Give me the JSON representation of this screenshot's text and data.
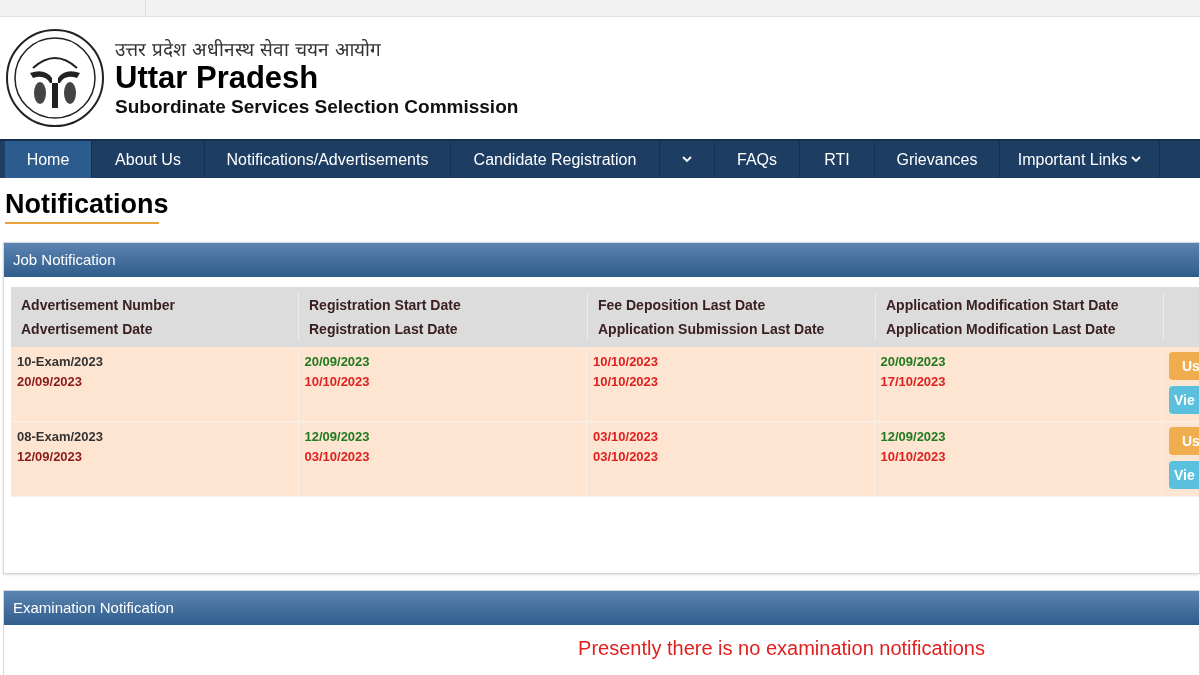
{
  "header": {
    "hindi_title": "उत्तर प्रदेश अधीनस्थ सेवा चयन आयोग",
    "title": "Uttar Pradesh",
    "subtitle": "Subordinate Services Selection Commission"
  },
  "nav": [
    {
      "label": "Home",
      "selected": true,
      "kind": "link"
    },
    {
      "label": "About Us",
      "selected": false,
      "kind": "link"
    },
    {
      "label": "Notifications/Advertisements",
      "selected": false,
      "kind": "link"
    },
    {
      "label": "Candidate Registration",
      "selected": false,
      "kind": "link"
    },
    {
      "selected": false,
      "kind": "caret"
    },
    {
      "label": "FAQs",
      "selected": false,
      "kind": "link"
    },
    {
      "label": "RTI",
      "selected": false,
      "kind": "link"
    },
    {
      "label": "Grievances",
      "selected": false,
      "kind": "link"
    },
    {
      "label": "Important Links",
      "selected": false,
      "kind": "dropdown"
    }
  ],
  "page_title": "Notifications",
  "job_panel": {
    "title": "Job Notification",
    "header_rows": [
      [
        "Advertisement Number",
        "Registration Start Date",
        "Fee Deposition Last Date",
        "Application Modification Start Date"
      ],
      [
        "Advertisement Date",
        "Registration Last Date",
        "Application Submission Last Date",
        "Application Modification Last Date"
      ]
    ],
    "rows": [
      {
        "cells": [
          [
            {
              "text": "10-Exam/2023",
              "color": "#333333"
            },
            {
              "text": "20/09/2023",
              "color": "#8b1a1a"
            }
          ],
          [
            {
              "text": "20/09/2023",
              "color": "#1f7a1f"
            },
            {
              "text": "10/10/2023",
              "color": "#e02020"
            }
          ],
          [
            {
              "text": "10/10/2023",
              "color": "#e02020"
            },
            {
              "text": "10/10/2023",
              "color": "#e02020"
            }
          ],
          [
            {
              "text": "20/09/2023",
              "color": "#1f7a1f"
            },
            {
              "text": "17/10/2023",
              "color": "#e02020"
            }
          ]
        ],
        "buttons": [
          {
            "label": "Us",
            "kind": "warning"
          },
          {
            "label": "Vie",
            "kind": "info"
          }
        ]
      },
      {
        "cells": [
          [
            {
              "text": "08-Exam/2023",
              "color": "#333333"
            },
            {
              "text": "12/09/2023",
              "color": "#8b1a1a"
            }
          ],
          [
            {
              "text": "12/09/2023",
              "color": "#1f7a1f"
            },
            {
              "text": "03/10/2023",
              "color": "#e02020"
            }
          ],
          [
            {
              "text": "03/10/2023",
              "color": "#e02020"
            },
            {
              "text": "03/10/2023",
              "color": "#e02020"
            }
          ],
          [
            {
              "text": "12/09/2023",
              "color": "#1f7a1f"
            },
            {
              "text": "10/10/2023",
              "color": "#e02020"
            }
          ]
        ],
        "buttons": [
          {
            "label": "Us",
            "kind": "warning"
          },
          {
            "label": "Vie",
            "kind": "info"
          }
        ]
      }
    ]
  },
  "exam_panel": {
    "title": "Examination Notification",
    "message": "Presently there is no examination notifications"
  }
}
